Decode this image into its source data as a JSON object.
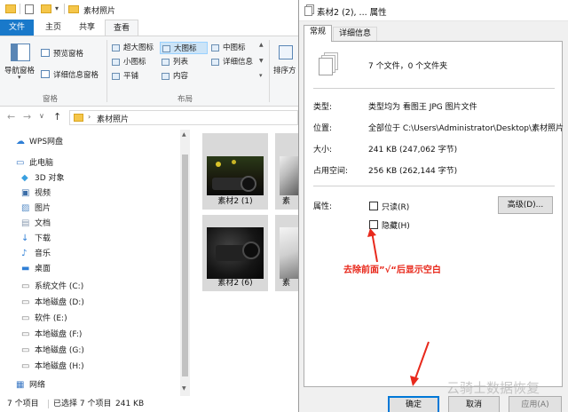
{
  "explorer": {
    "title_folder": "素材照片",
    "ribbon_tabs": [
      {
        "label": "文件"
      },
      {
        "label": "主页"
      },
      {
        "label": "共享"
      },
      {
        "label": "查看"
      }
    ],
    "pane_group": {
      "nav_pane": "导航窗格",
      "preview_pane": "预览窗格",
      "details_pane": "详细信息窗格",
      "group_label": "窗格"
    },
    "layout_group": {
      "items": [
        "超大图标",
        "大图标",
        "中图标",
        "小图标",
        "列表",
        "详细信息",
        "平铺",
        "内容"
      ],
      "selected": "大图标",
      "group_label": "布局"
    },
    "sort_label": "排序方",
    "address": {
      "path": "素材照片"
    },
    "nav_items": [
      {
        "label": "WPS网盘",
        "icon": "cloud-icon",
        "color": "#2f7fd6"
      },
      {
        "label": "此电脑",
        "icon": "computer-icon",
        "color": "#3b78c4"
      },
      {
        "label": "3D 对象",
        "icon": "cube-icon",
        "color": "#3aa0e0"
      },
      {
        "label": "视频",
        "icon": "video-icon",
        "color": "#3b6ea8"
      },
      {
        "label": "图片",
        "icon": "picture-icon",
        "color": "#5b8fc8"
      },
      {
        "label": "文档",
        "icon": "document-icon",
        "color": "#8a9bb0"
      },
      {
        "label": "下载",
        "icon": "download-icon",
        "color": "#2f7fd6"
      },
      {
        "label": "音乐",
        "icon": "music-icon",
        "color": "#2f7fd6"
      },
      {
        "label": "桌面",
        "icon": "desktop-icon",
        "color": "#2f7fd6"
      },
      {
        "label": "系统文件 (C:)",
        "icon": "drive-icon",
        "color": "#7a7a7a"
      },
      {
        "label": "本地磁盘 (D:)",
        "icon": "drive-icon",
        "color": "#7a7a7a"
      },
      {
        "label": "软件 (E:)",
        "icon": "drive-icon",
        "color": "#7a7a7a"
      },
      {
        "label": "本地磁盘 (F:)",
        "icon": "drive-icon",
        "color": "#7a7a7a"
      },
      {
        "label": "本地磁盘 (G:)",
        "icon": "drive-icon",
        "color": "#7a7a7a"
      },
      {
        "label": "本地磁盘 (H:)",
        "icon": "drive-icon",
        "color": "#7a7a7a"
      },
      {
        "label": "网络",
        "icon": "network-icon",
        "color": "#3b78c4"
      }
    ],
    "thumbnails": [
      {
        "caption": "素材2 (1)"
      },
      {
        "caption": "素"
      },
      {
        "caption": "素材2 (6)"
      },
      {
        "caption": "素"
      }
    ],
    "status": {
      "count": "7 个项目",
      "selected": "已选择 7 个项目",
      "size": "241 KB"
    }
  },
  "dialog": {
    "title": "素材2 (2), ... 属性",
    "tabs": [
      {
        "label": "常规"
      },
      {
        "label": "详细信息"
      }
    ],
    "summary": "7 个文件，0 个文件夹",
    "rows": [
      {
        "label": "类型:",
        "value": "类型均为 看图王 JPG 图片文件"
      },
      {
        "label": "位置:",
        "value": "全部位于 C:\\Users\\Administrator\\Desktop\\素材照片"
      },
      {
        "label": "大小:",
        "value": "241 KB (247,062 字节)"
      },
      {
        "label": "占用空间:",
        "value": "256 KB (262,144 字节)"
      }
    ],
    "attributes": {
      "label": "属性:",
      "readonly": {
        "label": "只读(R)",
        "checked": false
      },
      "hidden": {
        "label": "隐藏(H)",
        "checked": false
      },
      "advanced_button": "高级(D)..."
    },
    "annotation": "去除前面”√“后显示空白",
    "buttons": {
      "ok": "确定",
      "cancel": "取消",
      "apply": "应用(A)"
    },
    "watermark": "云骑士数据恢复",
    "accent_color": "#e8291c"
  }
}
